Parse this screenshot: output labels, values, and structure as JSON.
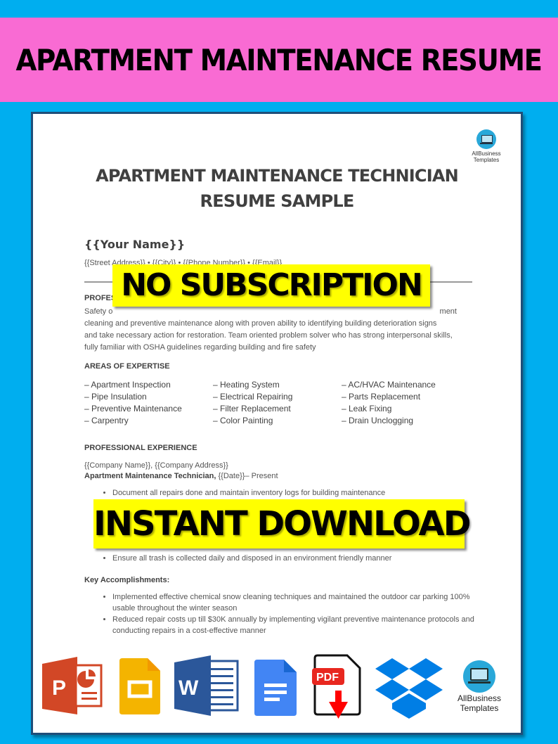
{
  "banner": {
    "title": "APARTMENT MAINTENANCE RESUME"
  },
  "document": {
    "logo": {
      "line1": "AllBusiness",
      "line2": "Templates",
      "icon": "laptop-icon"
    },
    "title_line1": "APARTMENT MAINTENANCE TECHNICIAN",
    "title_line2": "RESUME SAMPLE",
    "name": "{{Your Name}}",
    "contact": "{{Street Address}} • {{City}} • {{Phone Number}} • {{Email}}",
    "profile_heading": "PROFES",
    "profile_lines": [
      "Safety o",
      "ment",
      "cleaning and preventive maintenance along with proven ability to identifying building deterioration signs",
      "and take necessary action for restoration. Team oriented problem solver who has strong interpersonal skills,",
      "fully familiar with OSHA guidelines regarding building and fire safety"
    ],
    "expertise_heading": "AREAS OF EXPERTISE",
    "expertise": [
      "– Apartment Inspection",
      "– Heating System",
      "– AC/HVAC Maintenance",
      "– Pipe Insulation",
      "– Electrical Repairing",
      "– Parts Replacement",
      "– Preventive Maintenance",
      "– Filter Replacement",
      "– Leak Fixing",
      "– Carpentry",
      "– Color Painting",
      "– Drain Unclogging"
    ],
    "experience_heading": "PROFESSIONAL EXPERIENCE",
    "company_line": "{{Company Name}}, {{Company Address}}",
    "job_title": "Apartment Maintenance Technician,",
    "job_dates": " {{Date}}– Present",
    "duties": [
      "Document all repairs done and maintain inventory logs for building maintenance",
      "Ensure all trash is collected daily and disposed in an environment friendly manner"
    ],
    "accomplishments_heading": "Key Accomplishments:",
    "accomplishments": [
      "Implemented effective chemical snow cleaning techniques and maintained the outdoor car parking 100% usable throughout the winter season",
      "Reduced repair costs up till $30K annually by implementing vigilant preventive maintenance protocols and conducting repairs in a cost-effective manner"
    ]
  },
  "stamps": {
    "no_subscription": "NO SUBSCRIPTION",
    "instant_download": "INSTANT DOWNLOAD"
  },
  "format_icons": {
    "pdf_label": "PDF",
    "brand_line1": "AllBusiness",
    "brand_line2": "Templates",
    "items": [
      "powerpoint-icon",
      "google-slides-icon",
      "word-icon",
      "google-docs-icon",
      "pdf-download-icon",
      "dropbox-icon",
      "allbusiness-templates-logo"
    ]
  },
  "colors": {
    "background": "#00aeef",
    "banner": "#f96bd3",
    "stamp": "#ffff00",
    "page_border": "#1f4e79"
  }
}
